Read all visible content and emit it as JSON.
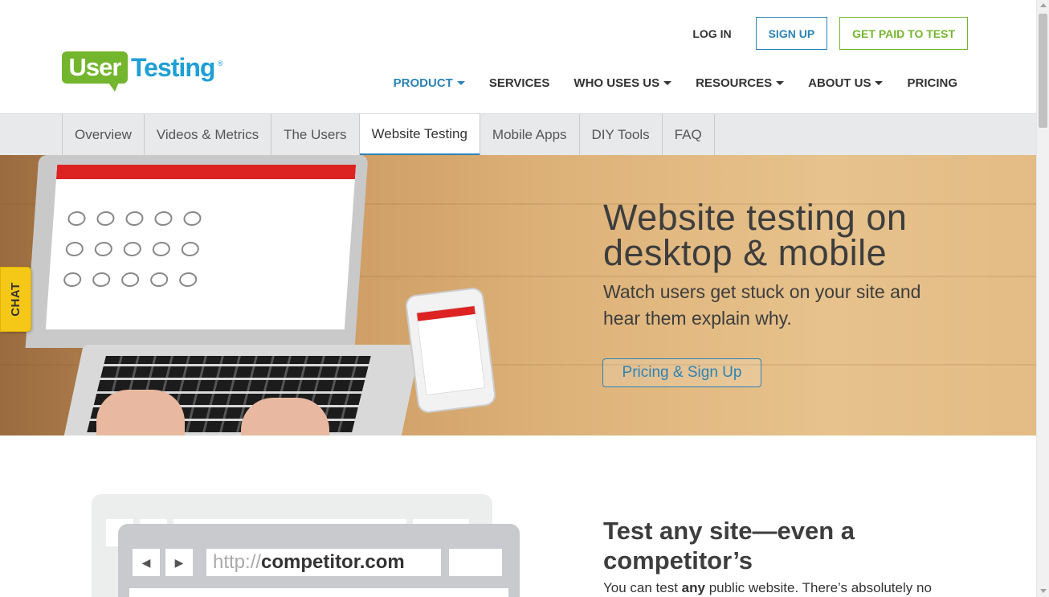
{
  "brand": {
    "logo_part1": "User",
    "logo_part2": "Testing",
    "logo_mark": "®",
    "green": "#74b52e",
    "blue": "#1e9fd6"
  },
  "top_actions": {
    "login": "LOG IN",
    "signup": "SIGN UP",
    "get_paid": "GET PAID TO TEST"
  },
  "main_nav": [
    {
      "label": "PRODUCT",
      "dropdown": true,
      "active": true
    },
    {
      "label": "SERVICES",
      "dropdown": false
    },
    {
      "label": "WHO USES US",
      "dropdown": true
    },
    {
      "label": "RESOURCES",
      "dropdown": true
    },
    {
      "label": "ABOUT US",
      "dropdown": true
    },
    {
      "label": "PRICING",
      "dropdown": false
    }
  ],
  "sub_nav": [
    {
      "label": "Overview"
    },
    {
      "label": "Videos & Metrics"
    },
    {
      "label": "The Users"
    },
    {
      "label": "Website Testing",
      "active": true
    },
    {
      "label": "Mobile Apps"
    },
    {
      "label": "DIY Tools"
    },
    {
      "label": "FAQ"
    }
  ],
  "hero": {
    "title_line1": "Website testing on",
    "title_line2": "desktop & mobile",
    "subtitle_line1": "Watch users get stuck on your site and",
    "subtitle_line2": "hear them explain why.",
    "cta": "Pricing & Sign Up"
  },
  "chat_tab": {
    "label": "CHAT"
  },
  "section": {
    "url_protocol": "http://",
    "url_domain": "competitor.com",
    "title_line1": "Test any site—even a",
    "title_line2": "competitor’s",
    "text_before": "You can test ",
    "text_bold": "any",
    "text_after": " public website. There’s absolutely no"
  },
  "colors": {
    "accent": "#2c83b6",
    "chat": "#f5c817"
  }
}
